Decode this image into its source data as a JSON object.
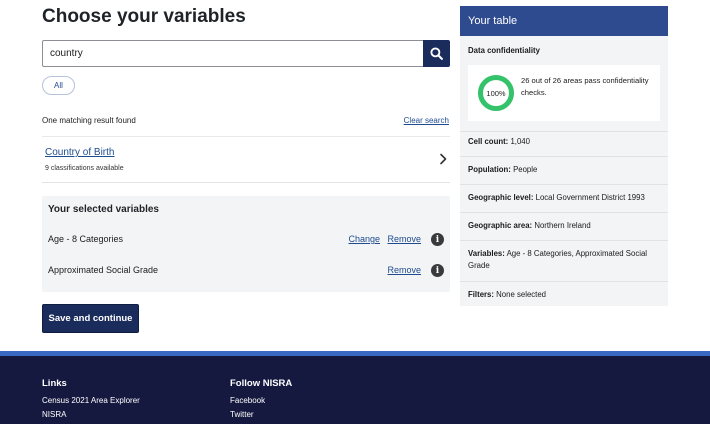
{
  "page_title": "Choose your variables",
  "search": {
    "value": "country",
    "placeholder": ""
  },
  "filter_pill": "All",
  "results": {
    "count_text": "One matching result found",
    "clear_label": "Clear search",
    "items": [
      {
        "name": "Country of Birth",
        "sub": "9 classifications available"
      }
    ]
  },
  "selected": {
    "title": "Your selected variables",
    "items": [
      {
        "label": "Age - 8 Categories",
        "change": "Change",
        "remove": "Remove"
      },
      {
        "label": "Approximated Social Grade",
        "remove": "Remove"
      }
    ]
  },
  "save_label": "Save and continue",
  "table_panel": {
    "title": "Your table",
    "confidentiality_title": "Data confidentiality",
    "confidentiality_percent": "100%",
    "confidentiality_fraction": 1.0,
    "confidentiality_text": "26 out of 26 areas pass confidentiality checks.",
    "rows": [
      {
        "label": "Cell count:",
        "value": "1,040"
      },
      {
        "label": "Population:",
        "value": "People"
      },
      {
        "label": "Geographic level:",
        "value": "Local Government District 1993"
      },
      {
        "label": "Geographic area:",
        "value": "Northern Ireland"
      },
      {
        "label": "Variables:",
        "value": "Age - 8 Categories, Approximated Social Grade"
      },
      {
        "label": "Filters:",
        "value": "None selected"
      }
    ]
  },
  "footer": {
    "links_title": "Links",
    "links": [
      "Census 2021 Area Explorer",
      "NISRA"
    ],
    "follow_title": "Follow NISRA",
    "follow": [
      "Facebook",
      "Twitter"
    ]
  },
  "colors": {
    "primary": "#1a2c5c",
    "panel_header": "#2e4b8f",
    "link": "#1f4b8f",
    "donut": "#34c36b",
    "footer": "#151940",
    "footer_stripe": "#3a69c4"
  },
  "icons": {
    "search": "search-icon",
    "chevron": "chevron-right-icon",
    "info": "info-icon"
  }
}
